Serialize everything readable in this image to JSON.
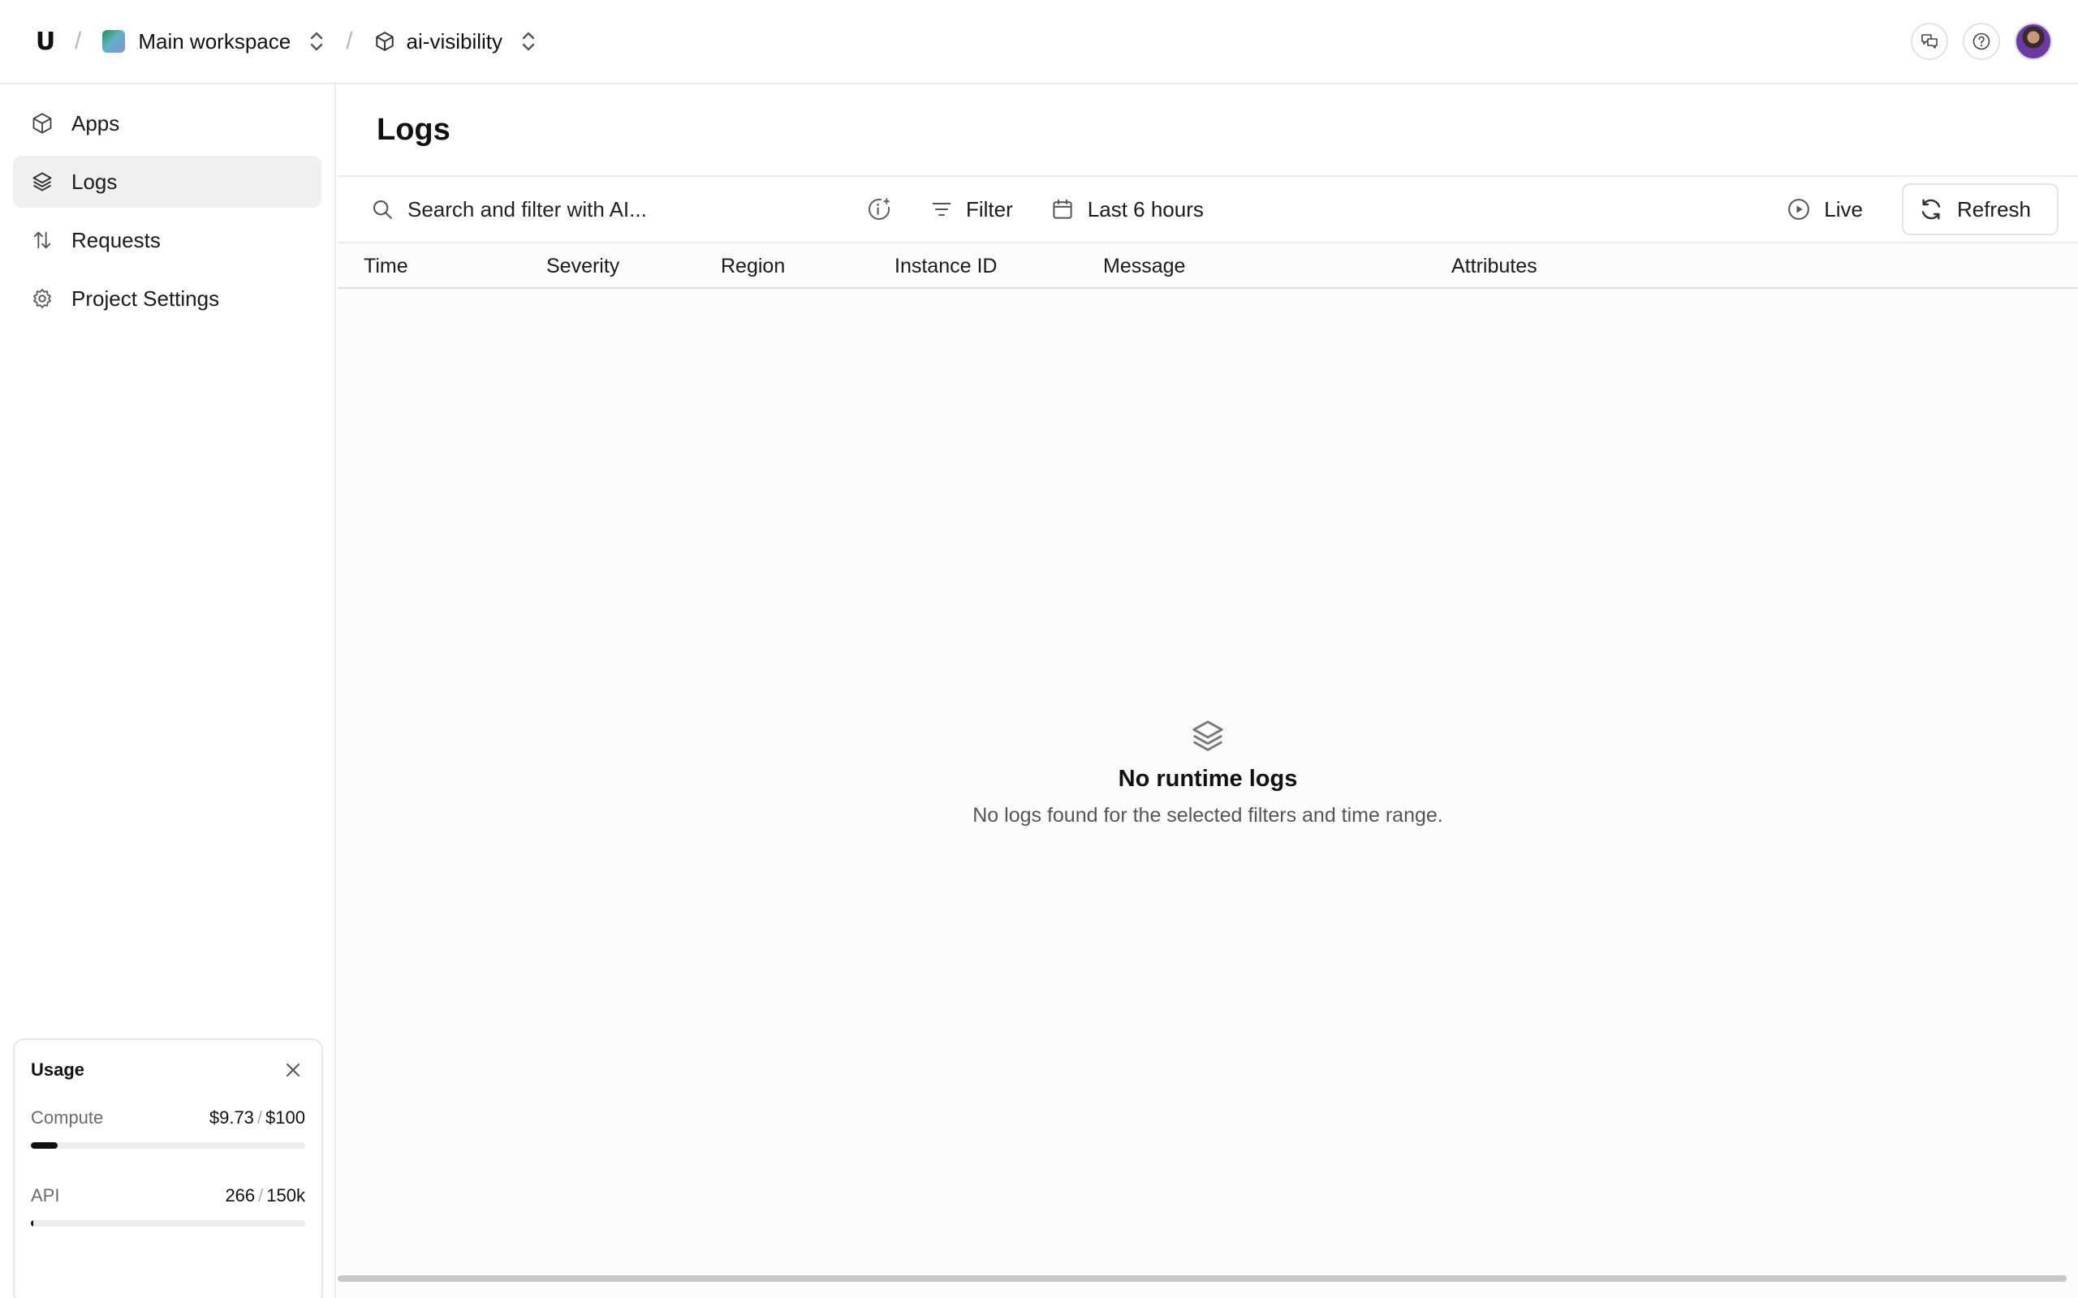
{
  "topbar": {
    "logo_text": "U",
    "separator": "/",
    "workspace_name": "Main workspace",
    "project_name": "ai-visibility"
  },
  "sidebar": {
    "items": [
      {
        "label": "Apps",
        "icon": "cube-icon"
      },
      {
        "label": "Logs",
        "icon": "layers-icon",
        "active": true
      },
      {
        "label": "Requests",
        "icon": "arrows-up-down-icon"
      },
      {
        "label": "Project Settings",
        "icon": "gear-icon"
      }
    ]
  },
  "usage": {
    "title": "Usage",
    "compute": {
      "label": "Compute",
      "used": "$9.73",
      "separator": "/",
      "limit": "$100",
      "fraction": 0.0973
    },
    "api": {
      "label": "API",
      "used": "266",
      "separator": "/",
      "limit": "150k",
      "fraction": 0.0018
    }
  },
  "main": {
    "title": "Logs",
    "toolbar": {
      "search_placeholder": "Search and filter with AI...",
      "filter_label": "Filter",
      "time_range_label": "Last 6 hours",
      "live_label": "Live",
      "refresh_label": "Refresh"
    },
    "columns": [
      "Time",
      "Severity",
      "Region",
      "Instance ID",
      "Message",
      "Attributes"
    ],
    "empty_state": {
      "title": "No runtime logs",
      "subtitle": "No logs found for the selected filters and time range."
    }
  }
}
